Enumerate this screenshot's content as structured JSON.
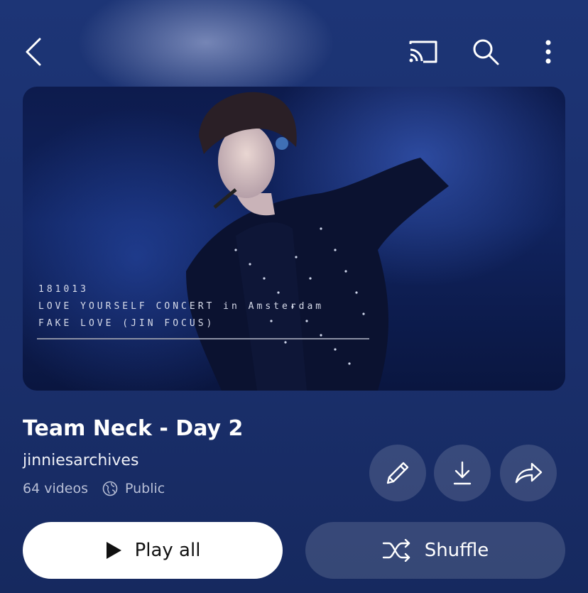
{
  "header": {
    "icons": [
      "back-chevron-icon",
      "cast-icon",
      "search-icon",
      "more-vertical-icon"
    ]
  },
  "thumbnail": {
    "caption_lines": [
      "181013",
      "LOVE YOURSELF CONCERT in Amsterdam",
      "FAKE LOVE (JIN FOCUS)"
    ]
  },
  "playlist": {
    "title": "Team Neck - Day 2",
    "owner": "jinniesarchives",
    "video_count": "64 videos",
    "visibility": "Public"
  },
  "actions": {
    "icons": [
      "pencil-icon",
      "download-icon",
      "share-icon"
    ],
    "play_all_label": "Play all",
    "shuffle_label": "Shuffle"
  },
  "colors": {
    "background_top": "#1d3576",
    "background_bottom": "#16295f",
    "play_button_bg": "#ffffff",
    "secondary_button_bg": "rgba(255,255,255,0.14)"
  }
}
